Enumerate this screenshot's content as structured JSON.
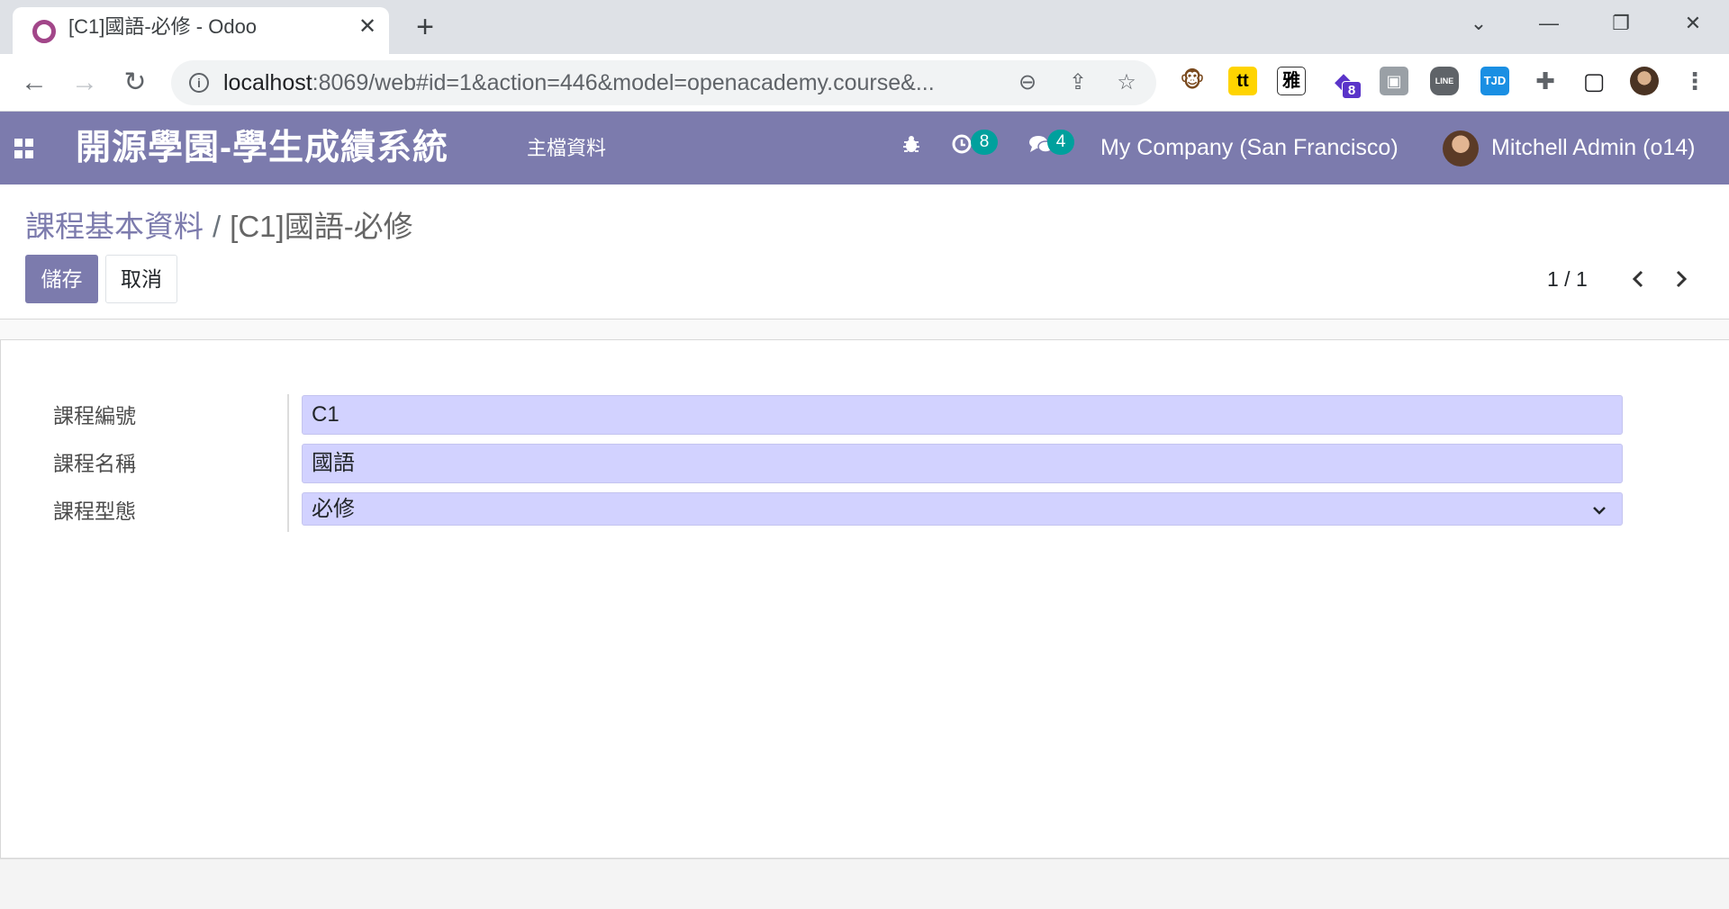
{
  "browser": {
    "tab_title": "[C1]國語-必修 - Odoo",
    "url_host": "localhost",
    "url_rest": ":8069/web#id=1&action=446&model=openacademy.course&...",
    "extensions": [
      {
        "name": "tampermonkey-icon",
        "color": "#f4b400",
        "glyph": "🐵"
      },
      {
        "name": "tt-extension-icon",
        "color": "#ffd400",
        "glyph": "tt"
      },
      {
        "name": "ya-extension-icon",
        "color": "#ffffff",
        "glyph": "雅"
      },
      {
        "name": "stack-extension-icon",
        "color": "#5a34c9",
        "glyph": "◆"
      },
      {
        "name": "profile-extension-icon",
        "color": "#9aa0a6",
        "glyph": "▣"
      },
      {
        "name": "line-extension-icon",
        "color": "#5f6368",
        "glyph": "LINE"
      },
      {
        "name": "tjd-extension-icon",
        "color": "#1a8fe3",
        "glyph": "TJD"
      }
    ],
    "stack_badge": "8"
  },
  "navbar": {
    "app_name": "開源學園-學生成績系統",
    "menu": "主檔資料",
    "activity_count": "8",
    "message_count": "4",
    "company": "My Company (San Francisco)",
    "user": "Mitchell Admin (o14)"
  },
  "control_panel": {
    "breadcrumb_parent": "課程基本資料",
    "breadcrumb_separator": "/",
    "breadcrumb_current": "[C1]國語-必修",
    "save_label": "儲存",
    "discard_label": "取消",
    "pager": "1 / 1"
  },
  "form": {
    "code_label": "課程編號",
    "code_value": "C1",
    "name_label": "課程名稱",
    "name_value": "國語",
    "type_label": "課程型態",
    "type_value": "必修"
  },
  "colors": {
    "navbar": "#7c7bad",
    "primary_button": "#7c7bad",
    "badge": "#00a09d",
    "required_field": "#d2d2ff"
  }
}
